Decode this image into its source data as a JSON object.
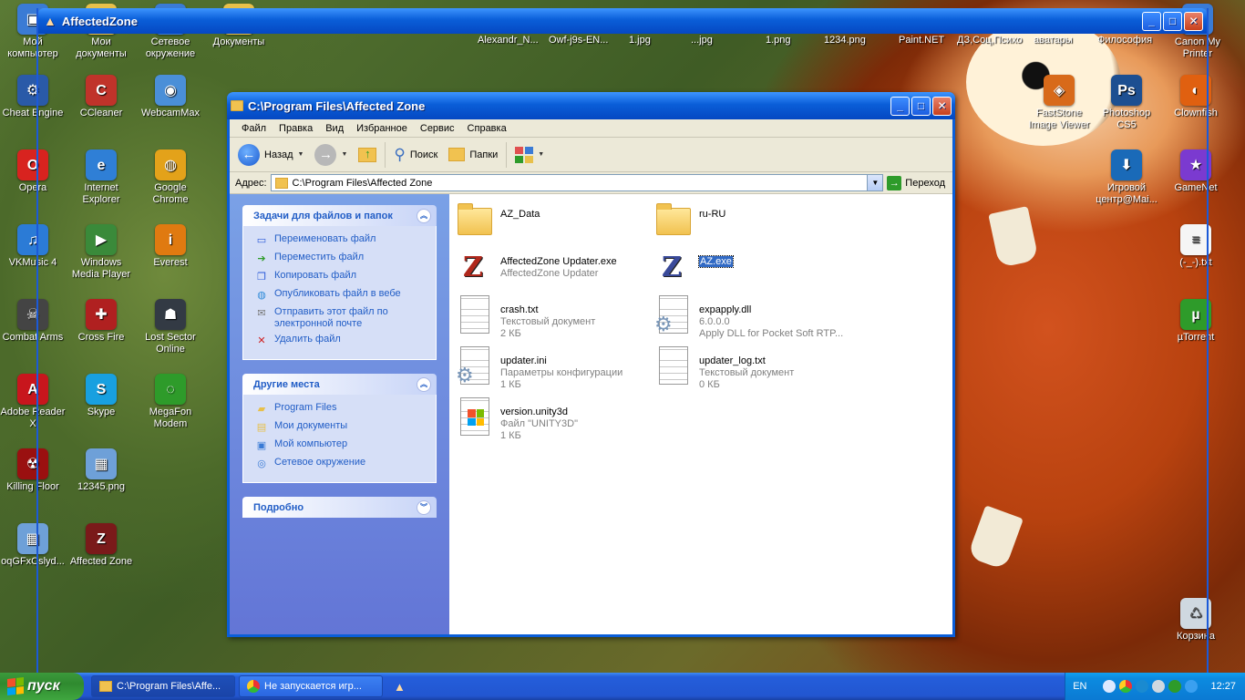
{
  "desktop": {
    "top_labels": [
      {
        "label": "Alexandr_N..."
      },
      {
        "label": "Owf-j9s-EN..."
      },
      {
        "label": "1.jpg"
      },
      {
        "label": "...jpg"
      },
      {
        "label": "1.png"
      },
      {
        "label": "1234.png"
      },
      {
        "label": "Paint.NET"
      },
      {
        "label": "ДЗ,Соц,Психо"
      },
      {
        "label": "аватары"
      },
      {
        "label": "Философия"
      }
    ],
    "left_icons": [
      {
        "label": "Мой компьютер",
        "name": "my-computer",
        "color": "#3a7bd5",
        "glyph": "▣"
      },
      {
        "label": "Мои документы",
        "name": "my-documents",
        "color": "#e8c04a",
        "glyph": "▤"
      },
      {
        "label": "Сетевое окружение",
        "name": "network-places",
        "color": "#3a7bd5",
        "glyph": "◎"
      },
      {
        "label": "Документы",
        "name": "documents",
        "color": "#e8c04a",
        "glyph": "▤"
      },
      {
        "label": "Cheat Engine",
        "name": "cheat-engine",
        "color": "#2a5aa8",
        "glyph": "⚙"
      },
      {
        "label": "CCleaner",
        "name": "ccleaner",
        "color": "#c0332a",
        "glyph": "C"
      },
      {
        "label": "WebcamMax",
        "name": "webcammax",
        "color": "#4a8fd8",
        "glyph": "◉"
      },
      {
        "label": "Opera",
        "name": "opera",
        "color": "#d8231f",
        "glyph": "O"
      },
      {
        "label": "Internet Explorer",
        "name": "internet-explorer",
        "color": "#2f7fd6",
        "glyph": "e"
      },
      {
        "label": "Google Chrome",
        "name": "google-chrome",
        "color": "#e3a21a",
        "glyph": "◍"
      },
      {
        "label": "VKMusic 4",
        "name": "vkmusic",
        "color": "#2b7bd6",
        "glyph": "♫"
      },
      {
        "label": "Windows Media Player",
        "name": "media-player",
        "color": "#3a8a3a",
        "glyph": "▶"
      },
      {
        "label": "Everest",
        "name": "everest",
        "color": "#e07a10",
        "glyph": "i"
      },
      {
        "label": "Combat Arms",
        "name": "combat-arms",
        "color": "#444444",
        "glyph": "☠"
      },
      {
        "label": "Cross Fire",
        "name": "cross-fire",
        "color": "#b02020",
        "glyph": "✚"
      },
      {
        "label": "Lost Sector Online",
        "name": "lost-sector-online",
        "color": "#333a44",
        "glyph": "☗"
      },
      {
        "label": "Adobe Reader X",
        "name": "adobe-reader",
        "color": "#c8161d",
        "glyph": "A"
      },
      {
        "label": "Skype",
        "name": "skype",
        "color": "#18a0e0",
        "glyph": "S"
      },
      {
        "label": "MegaFon Modem",
        "name": "megafon-modem",
        "color": "#2e9b2a",
        "glyph": "◌"
      },
      {
        "label": "Killing Floor",
        "name": "killing-floor",
        "color": "#9a1010",
        "glyph": "☢"
      },
      {
        "label": "12345.png",
        "name": "png-file",
        "color": "#6ea0d8",
        "glyph": "▦"
      },
      {
        "label": "oqGFxCslyd...",
        "name": "image-file",
        "color": "#6ea0d8",
        "glyph": "▦"
      },
      {
        "label": "Affected Zone",
        "name": "affected-zone",
        "color": "#7a1a1a",
        "glyph": "Z"
      }
    ],
    "right_icons": [
      {
        "label": "Canon My Printer",
        "name": "canon-printer",
        "color": "#3a7bd5",
        "glyph": "▭"
      },
      {
        "label": "FastStone Image Viewer",
        "name": "faststone",
        "color": "#d86a1a",
        "glyph": "◈"
      },
      {
        "label": "Photoshop CS5",
        "name": "photoshop",
        "color": "#1d4f91",
        "glyph": "Ps"
      },
      {
        "label": "Clownfish",
        "name": "clownfish",
        "color": "#e06010",
        "glyph": "◐"
      },
      {
        "label": "Игровой центр@Mai...",
        "name": "game-center",
        "color": "#1a6ab8",
        "glyph": "⬇"
      },
      {
        "label": "GameNet",
        "name": "gamenet",
        "color": "#7b3ad0",
        "glyph": "★"
      },
      {
        "label": "(-_-).txt",
        "name": "txt-file",
        "color": "#f5f5f5",
        "glyph": "≡"
      },
      {
        "label": "µTorrent",
        "name": "utorrent",
        "color": "#2e9b2a",
        "glyph": "µ"
      },
      {
        "label": "Корзина",
        "name": "recycle-bin",
        "color": "#cfd8e0",
        "glyph": "♺"
      }
    ]
  },
  "bg_window": {
    "title": "AffectedZone"
  },
  "explorer": {
    "title": "C:\\Program Files\\Affected Zone",
    "menu": [
      "Файл",
      "Правка",
      "Вид",
      "Избранное",
      "Сервис",
      "Справка"
    ],
    "toolbar": {
      "back": "Назад",
      "search": "Поиск",
      "folders": "Папки"
    },
    "address": {
      "label": "Адрес:",
      "value": "C:\\Program Files\\Affected Zone",
      "go": "Переход"
    },
    "tasks_panel": {
      "title": "Задачи для файлов и папок",
      "items": [
        {
          "label": "Переименовать файл",
          "icon": "rename-icon",
          "glyph": "▭",
          "color": "#2a5ad8"
        },
        {
          "label": "Переместить файл",
          "icon": "move-icon",
          "glyph": "➔",
          "color": "#2e9b2a"
        },
        {
          "label": "Копировать файл",
          "icon": "copy-icon",
          "glyph": "❐",
          "color": "#2a5ad8"
        },
        {
          "label": "Опубликовать файл в вебе",
          "icon": "globe-icon",
          "glyph": "◍",
          "color": "#2e8ad8"
        },
        {
          "label": "Отправить этот файл по электронной почте",
          "icon": "mail-icon",
          "glyph": "✉",
          "color": "#777777"
        },
        {
          "label": "Удалить файл",
          "icon": "delete-icon",
          "glyph": "✕",
          "color": "#d02020"
        }
      ]
    },
    "places_panel": {
      "title": "Другие места",
      "items": [
        {
          "label": "Program Files",
          "icon": "folder-icon",
          "glyph": "▰",
          "color": "#e8c04a"
        },
        {
          "label": "Мои документы",
          "icon": "documents-icon",
          "glyph": "▤",
          "color": "#e8c04a"
        },
        {
          "label": "Мой компьютер",
          "icon": "computer-icon",
          "glyph": "▣",
          "color": "#3a7bd5"
        },
        {
          "label": "Сетевое окружение",
          "icon": "network-icon",
          "glyph": "◎",
          "color": "#3a7bd5"
        }
      ]
    },
    "details_panel": {
      "title": "Подробно"
    },
    "files": [
      {
        "name": "AZ_Data",
        "line2": "",
        "line3": "",
        "type": "folder"
      },
      {
        "name": "ru-RU",
        "line2": "",
        "line3": "",
        "type": "folder"
      },
      {
        "name": "AffectedZone Updater.exe",
        "line2": "AffectedZone Updater",
        "line3": "",
        "type": "az"
      },
      {
        "name": "AZ.exe",
        "line2": "",
        "line3": "",
        "type": "az-blue",
        "selected": true
      },
      {
        "name": "crash.txt",
        "line2": "Текстовый документ",
        "line3": "2 КБ",
        "type": "doc"
      },
      {
        "name": "expapply.dll",
        "line2": "6.0.0.0",
        "line3": "Apply DLL for Pocket Soft RTP...",
        "type": "gear"
      },
      {
        "name": "updater.ini",
        "line2": "Параметры конфигурации",
        "line3": "1 КБ",
        "type": "gear"
      },
      {
        "name": "updater_log.txt",
        "line2": "Текстовый документ",
        "line3": "0 КБ",
        "type": "doc"
      },
      {
        "name": "version.unity3d",
        "line2": "Файл \"UNITY3D\"",
        "line3": "1 КБ",
        "type": "win"
      }
    ]
  },
  "taskbar": {
    "start": "пуск",
    "tasks": [
      {
        "label": "C:\\Program Files\\Affe...",
        "icon": "folder-icon",
        "active": true
      },
      {
        "label": "Не запускается игр...",
        "icon": "chrome-icon",
        "active": false
      }
    ],
    "lang": "EN",
    "clock": "12:27"
  }
}
